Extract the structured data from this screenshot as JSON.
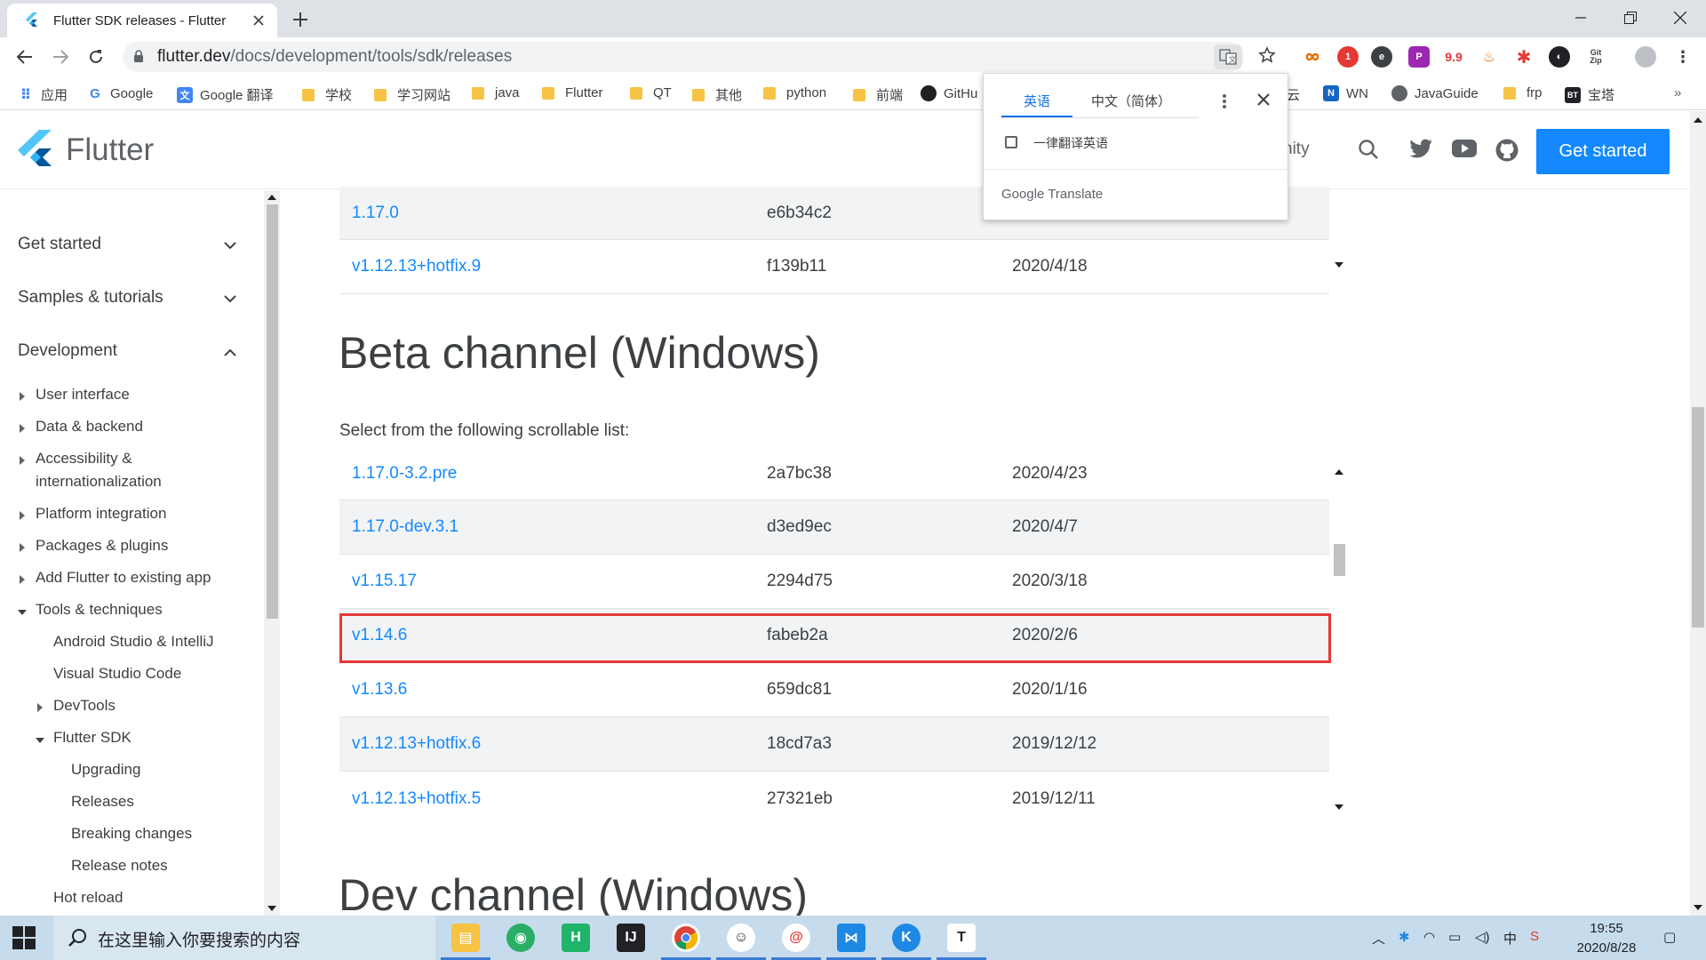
{
  "browser": {
    "tab_title": "Flutter SDK releases - Flutter",
    "url_host": "flutter.dev",
    "url_path": "/docs/development/tools/sdk/releases"
  },
  "bookmarks": [
    {
      "label": "应用",
      "icon": "apps-grid-icon"
    },
    {
      "label": "Google",
      "icon": "google-icon"
    },
    {
      "label": "Google 翻译",
      "icon": "google-translate-icon"
    },
    {
      "label": "学校",
      "icon": "folder-icon"
    },
    {
      "label": "学习网站",
      "icon": "folder-icon"
    },
    {
      "label": "java",
      "icon": "folder-icon"
    },
    {
      "label": "Flutter",
      "icon": "folder-icon"
    },
    {
      "label": "QT",
      "icon": "folder-icon"
    },
    {
      "label": "其他",
      "icon": "folder-icon"
    },
    {
      "label": "python",
      "icon": "folder-icon"
    },
    {
      "label": "前端",
      "icon": "folder-icon"
    },
    {
      "label": "GitHu",
      "icon": "github-icon"
    },
    {
      "label": "云",
      "icon": "cloud-icon"
    },
    {
      "label": "WN",
      "icon": "wn-icon"
    },
    {
      "label": "JavaGuide",
      "icon": "globe-icon"
    },
    {
      "label": "frp",
      "icon": "folder-icon"
    },
    {
      "label": "宝塔",
      "icon": "bt-icon"
    }
  ],
  "site": {
    "brand": "Flutter",
    "community_partial": "nity",
    "get_started": "Get started"
  },
  "sidenav": {
    "top": [
      {
        "label": "Get started",
        "expanded": false
      },
      {
        "label": "Samples & tutorials",
        "expanded": false
      },
      {
        "label": "Development",
        "expanded": true
      }
    ],
    "items": [
      "User interface",
      "Data & backend",
      "Accessibility &",
      "internationalization",
      "Platform integration",
      "Packages & plugins",
      "Add Flutter to existing app",
      "Tools & techniques",
      "Android Studio & IntelliJ",
      "Visual Studio Code",
      "DevTools",
      "Flutter SDK",
      "Upgrading",
      "Releases",
      "Breaking changes",
      "Release notes",
      "Hot reload"
    ]
  },
  "stable_rows": [
    {
      "version": "1.17.0",
      "hash": "e6b34c2",
      "date": ""
    },
    {
      "version": "v1.12.13+hotfix.9",
      "hash": "f139b11",
      "date": "2020/4/18"
    }
  ],
  "beta": {
    "heading": "Beta channel (Windows)",
    "select_text": "Select from the following scrollable list:",
    "rows": [
      {
        "version": "1.17.0-3.2.pre",
        "hash": "2a7bc38",
        "date": "2020/4/23"
      },
      {
        "version": "1.17.0-dev.3.1",
        "hash": "d3ed9ec",
        "date": "2020/4/7"
      },
      {
        "version": "v1.15.17",
        "hash": "2294d75",
        "date": "2020/3/18"
      },
      {
        "version": "v1.14.6",
        "hash": "fabeb2a",
        "date": "2020/2/6"
      },
      {
        "version": "v1.13.6",
        "hash": "659dc81",
        "date": "2020/1/16"
      },
      {
        "version": "v1.12.13+hotfix.6",
        "hash": "18cd7a3",
        "date": "2019/12/12"
      },
      {
        "version": "v1.12.13+hotfix.5",
        "hash": "27321eb",
        "date": "2019/12/11"
      }
    ]
  },
  "dev": {
    "heading": "Dev channel (Windows)"
  },
  "translate_popup": {
    "tab_source": "英语",
    "tab_target": "中文（简体）",
    "always_translate": "一律翻译英语",
    "footer_google": "Google",
    "footer_translate": "Translate"
  },
  "taskbar": {
    "search_placeholder": "在这里输入你要搜索的内容",
    "time": "19:55",
    "date": "2020/8/28",
    "ime": "中"
  },
  "colors": {
    "accent": "#1389fd",
    "highlight_border": "#e53935",
    "taskbar": "#c6dcec"
  }
}
